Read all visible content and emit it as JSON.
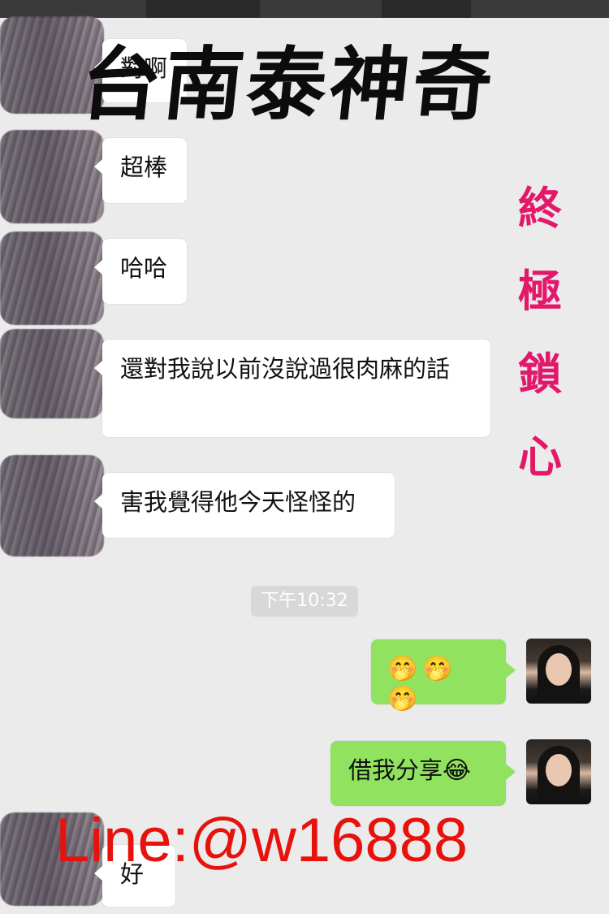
{
  "chat": {
    "incoming": [
      {
        "text": "對啊"
      },
      {
        "text": "超棒"
      },
      {
        "text": "哈哈"
      },
      {
        "text": "還對我說以前沒說過很肉麻的話"
      },
      {
        "text": "害我覺得他今天怪怪的"
      },
      {
        "text": "好"
      }
    ],
    "timestamp": "下午10:32",
    "outgoing": [
      {
        "text": "",
        "emojis": [
          "🤭",
          "🤭",
          "🤭"
        ]
      },
      {
        "text": "借我分享",
        "emojis": [
          "😂"
        ]
      }
    ]
  },
  "overlay": {
    "title": "台南泰神奇",
    "vertical": [
      "終",
      "極",
      "鎖",
      "心"
    ],
    "contact": "Line:@w16888"
  },
  "colors": {
    "background": "#ebebec",
    "outgoing_bubble": "#91e25f",
    "incoming_bubble": "#ffffff",
    "vertical_text": "#e3186b",
    "contact_text": "#e8120c"
  }
}
